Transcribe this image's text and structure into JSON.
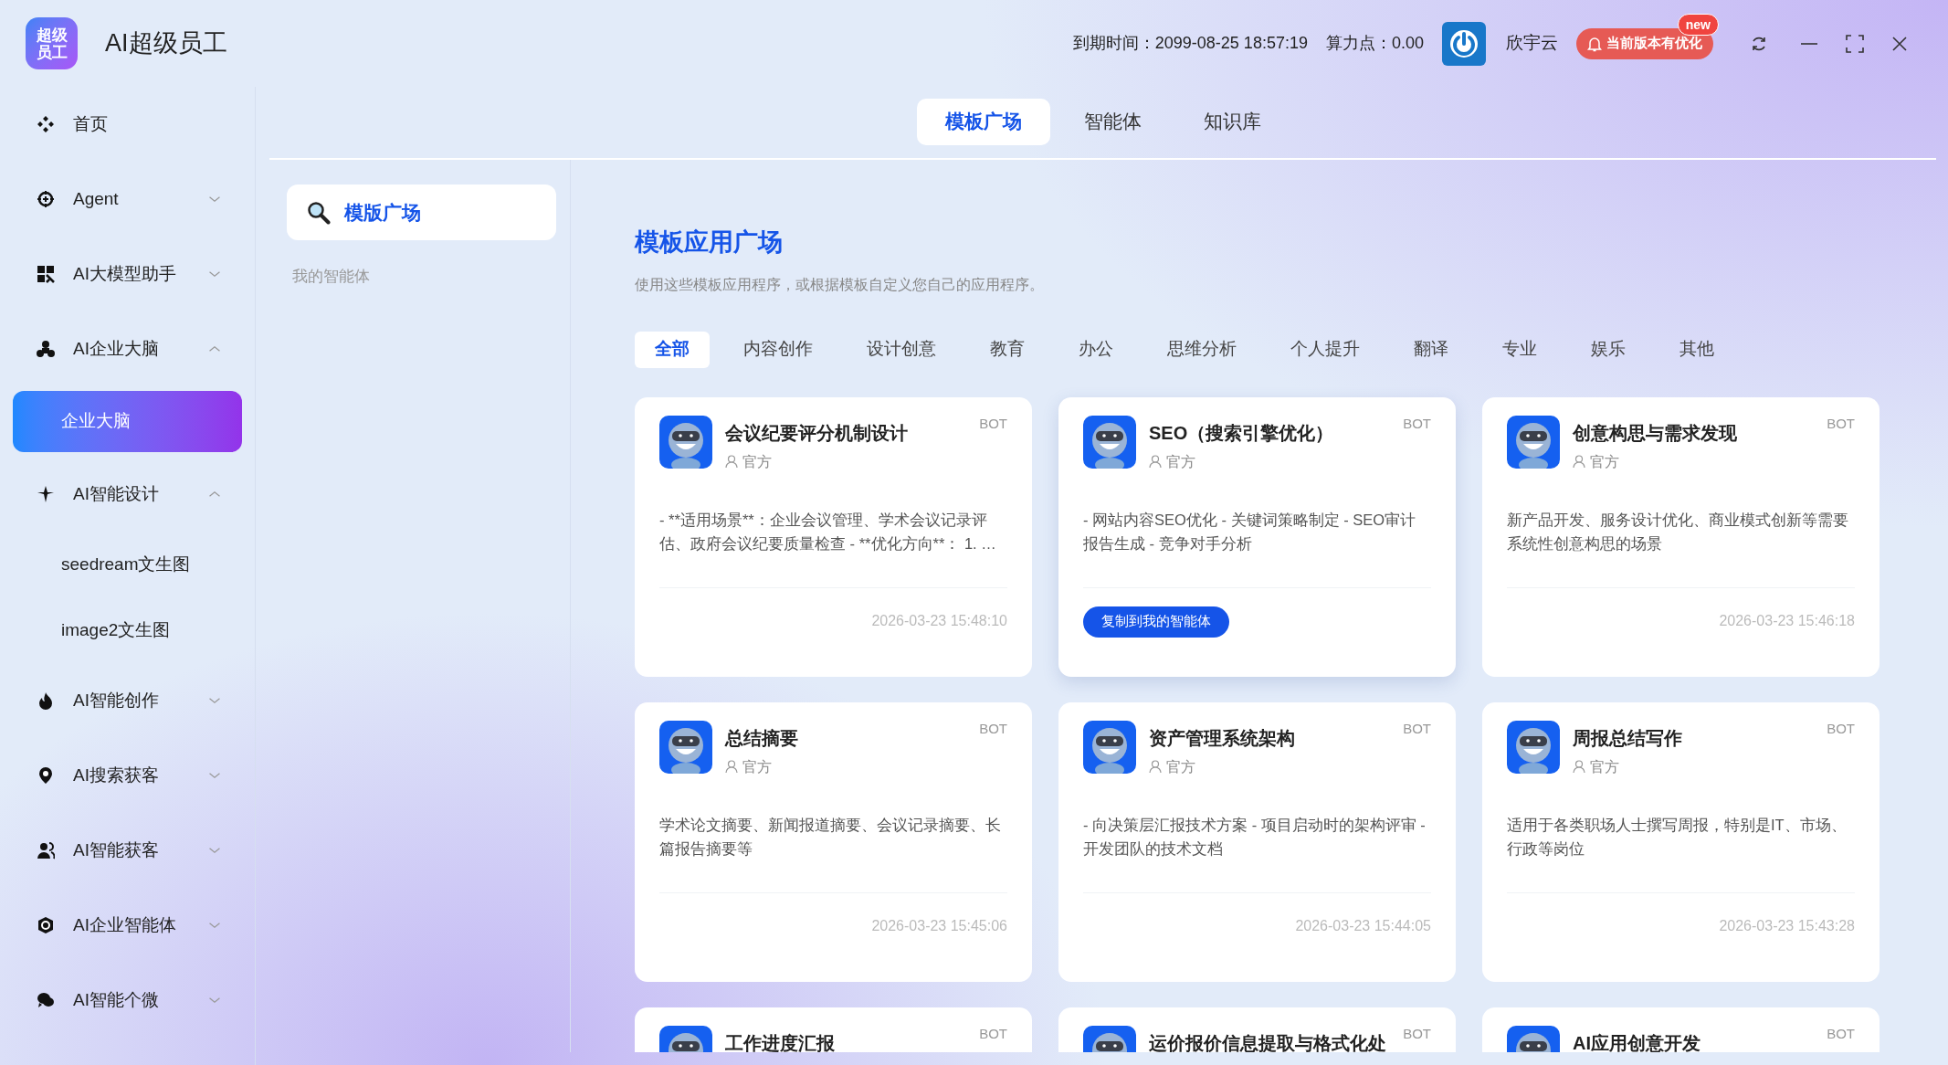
{
  "app": {
    "title": "AI超级员工",
    "logo": [
      "超级",
      "员工"
    ]
  },
  "header": {
    "expiry": "到期时间：2099-08-25 18:57:19",
    "points": "算力点：0.00",
    "user": "欣宇云",
    "update_button": "当前版本有优化",
    "update_badge": "new"
  },
  "sidebar": {
    "items": [
      {
        "label": "首页",
        "kind": "link",
        "selected": false
      },
      {
        "label": "Agent",
        "kind": "group",
        "expanded": false,
        "selected": false
      },
      {
        "label": "AI大模型助手",
        "kind": "group",
        "expanded": false,
        "selected": false
      },
      {
        "label": "AI企业大脑",
        "kind": "group",
        "expanded": true,
        "selected": false,
        "children": [
          {
            "label": "企业大脑",
            "selected": true
          }
        ]
      },
      {
        "label": "AI智能设计",
        "kind": "group",
        "expanded": true,
        "selected": false,
        "children": [
          {
            "label": "seedream文生图",
            "selected": false
          },
          {
            "label": "image2文生图",
            "selected": false
          }
        ]
      },
      {
        "label": "AI智能创作",
        "kind": "group",
        "expanded": false,
        "selected": false
      },
      {
        "label": "AI搜索获客",
        "kind": "group",
        "expanded": false,
        "selected": false
      },
      {
        "label": "AI智能获客",
        "kind": "group",
        "expanded": false,
        "selected": false
      },
      {
        "label": "AI企业智能体",
        "kind": "group",
        "expanded": false,
        "selected": false
      },
      {
        "label": "AI智能个微",
        "kind": "group",
        "expanded": false,
        "selected": false
      }
    ]
  },
  "top_tabs": [
    {
      "label": "模板广场",
      "selected": true
    },
    {
      "label": "智能体",
      "selected": false
    },
    {
      "label": "知识库",
      "selected": false
    }
  ],
  "sub_nav": [
    {
      "label": "模版广场",
      "selected": true
    },
    {
      "label": "我的智能体",
      "selected": false
    }
  ],
  "main": {
    "title": "模板应用广场",
    "subtitle": "使用这些模板应用程序，或根据模板自定义您自己的应用程序。",
    "categories": [
      {
        "label": "全部",
        "selected": true
      },
      {
        "label": "内容创作",
        "selected": false
      },
      {
        "label": "设计创意",
        "selected": false
      },
      {
        "label": "教育",
        "selected": false
      },
      {
        "label": "办公",
        "selected": false
      },
      {
        "label": "思维分析",
        "selected": false
      },
      {
        "label": "个人提升",
        "selected": false
      },
      {
        "label": "翻译",
        "selected": false
      },
      {
        "label": "专业",
        "selected": false
      },
      {
        "label": "娱乐",
        "selected": false
      },
      {
        "label": "其他",
        "selected": false
      }
    ],
    "cards": [
      {
        "title": "会议纪要评分机制设计",
        "author": "官方",
        "badge": "BOT",
        "description": "- **适用场景**：企业会议管理、学术会议记录评估、政府会议纪要质量检查 - **优化方向**： 1. …",
        "date": "2026-03-23 15:48:10",
        "hovered": false
      },
      {
        "title": "SEO（搜索引擎优化）",
        "author": "官方",
        "badge": "BOT",
        "description": "- 网站内容SEO优化 - 关键词策略制定 - SEO审计报告生成 - 竞争对手分析",
        "action": "复制到我的智能体",
        "hovered": true
      },
      {
        "title": "创意构思与需求发现",
        "author": "官方",
        "badge": "BOT",
        "description": "新产品开发、服务设计优化、商业模式创新等需要系统性创意构思的场景",
        "date": "2026-03-23 15:46:18",
        "hovered": false
      },
      {
        "title": "总结摘要",
        "author": "官方",
        "badge": "BOT",
        "description": "学术论文摘要、新闻报道摘要、会议记录摘要、长篇报告摘要等",
        "date": "2026-03-23 15:45:06",
        "hovered": false
      },
      {
        "title": "资产管理系统架构",
        "author": "官方",
        "badge": "BOT",
        "description": "- 向决策层汇报技术方案 - 项目启动时的架构评审 - 开发团队的技术文档",
        "date": "2026-03-23 15:44:05",
        "hovered": false
      },
      {
        "title": "周报总结写作",
        "author": "官方",
        "badge": "BOT",
        "description": "适用于各类职场人士撰写周报，特别是IT、市场、行政等岗位",
        "date": "2026-03-23 15:43:28",
        "hovered": false
      },
      {
        "title": "工作进度汇报",
        "badge": "BOT",
        "hovered": false
      },
      {
        "title": "运价报价信息提取与格式化处",
        "badge": "BOT",
        "hovered": false
      },
      {
        "title": "AI应用创意开发",
        "badge": "BOT",
        "hovered": false
      }
    ]
  }
}
